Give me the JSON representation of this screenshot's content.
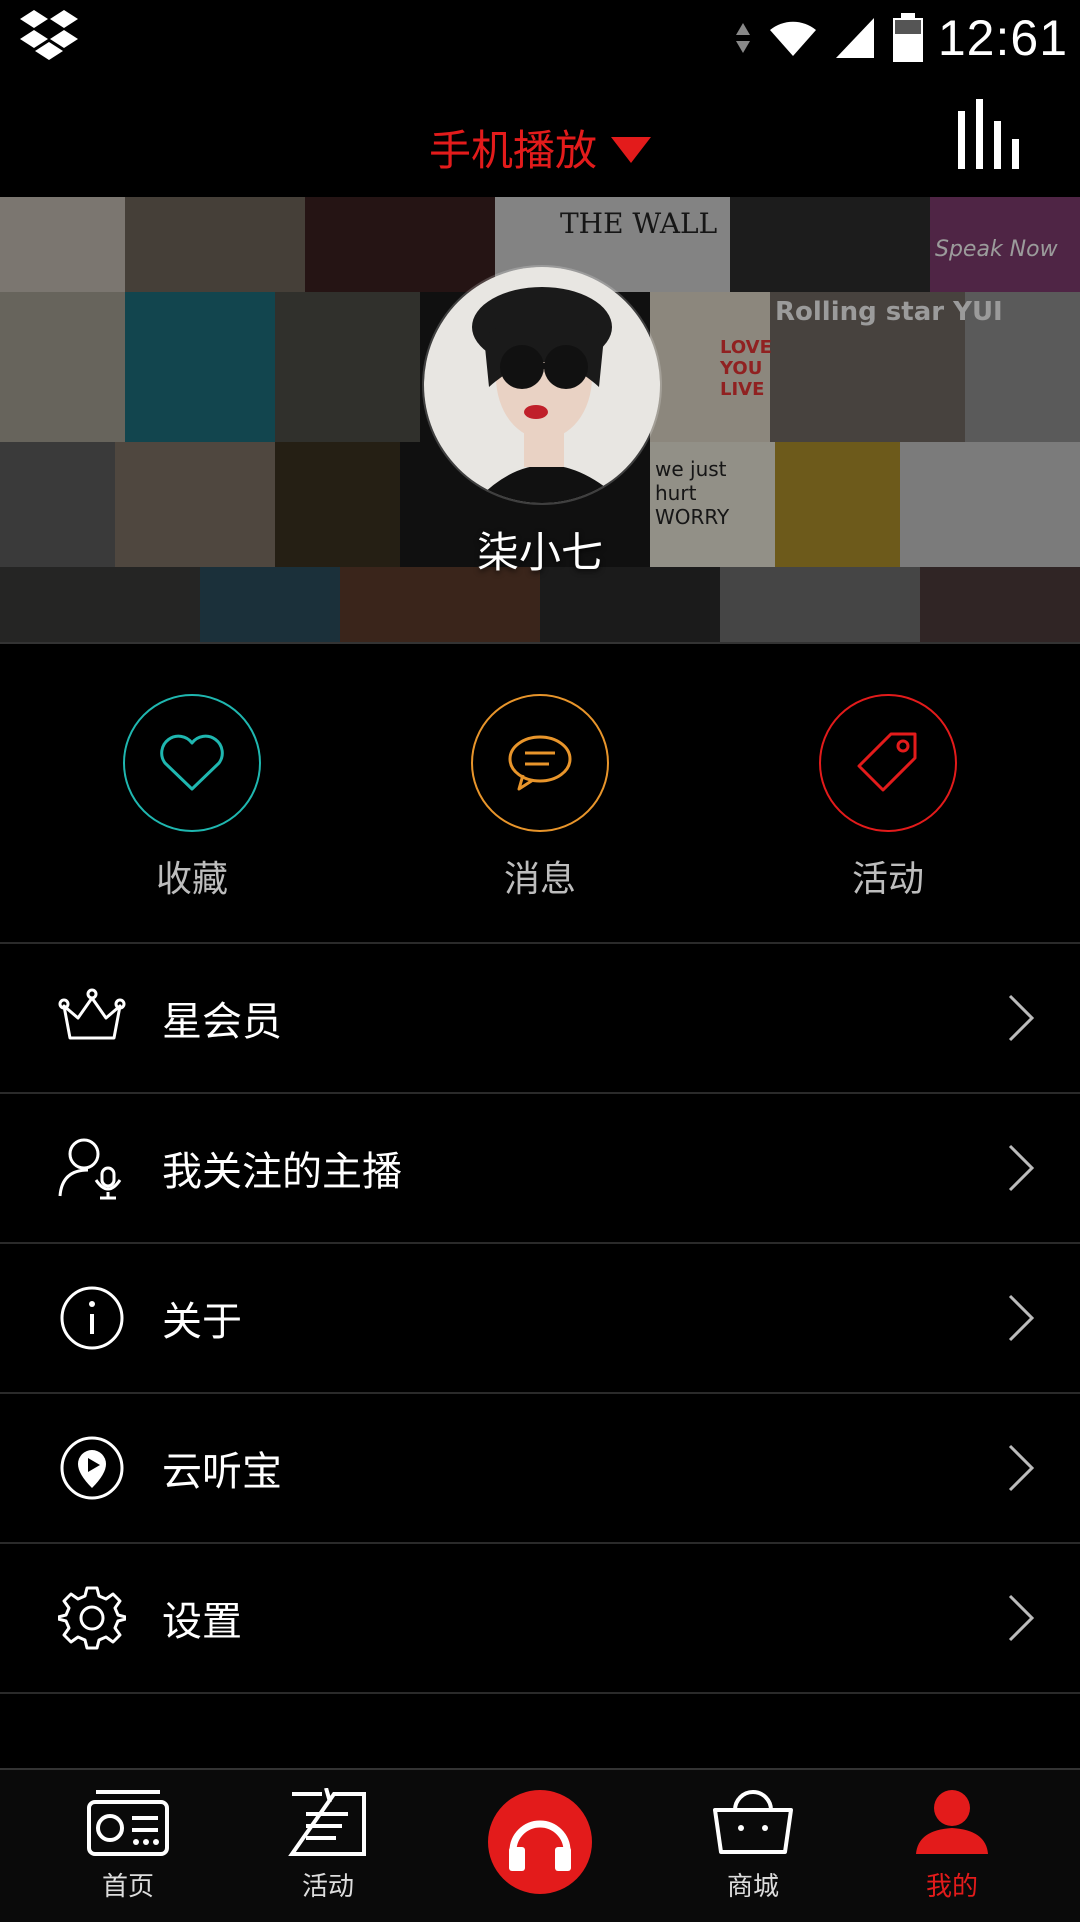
{
  "status_bar": {
    "time": "12:61"
  },
  "header": {
    "title": "手机播放"
  },
  "profile": {
    "username": "柒小七"
  },
  "quick_actions": [
    {
      "label": "收藏",
      "icon": "heart-icon",
      "color": "#1fb7b0"
    },
    {
      "label": "消息",
      "icon": "message-icon",
      "color": "#e8952b"
    },
    {
      "label": "活动",
      "icon": "tag-icon",
      "color": "#e31b1b"
    }
  ],
  "menu": [
    {
      "label": "星会员",
      "icon": "crown-icon"
    },
    {
      "label": "我关注的主播",
      "icon": "user-mic-icon"
    },
    {
      "label": "关于",
      "icon": "info-icon"
    },
    {
      "label": "云听宝",
      "icon": "play-pin-icon"
    },
    {
      "label": "设置",
      "icon": "gear-icon"
    }
  ],
  "tabbar": [
    {
      "label": "首页",
      "icon": "radio-icon"
    },
    {
      "label": "活动",
      "icon": "list-board-icon"
    },
    {
      "label": "",
      "icon": "headphones-icon"
    },
    {
      "label": "商城",
      "icon": "basket-icon"
    },
    {
      "label": "我的",
      "icon": "user-icon",
      "active": true
    }
  ],
  "colors": {
    "accent": "#e31b1b",
    "teal": "#1fb7b0",
    "orange": "#e8952b"
  },
  "banner_texts": {
    "album1": "THE WALL",
    "album2": "Rolling star YUI",
    "album3": "we just hurt WORRY",
    "album4": "Speak Now",
    "album5": "LOVE YOU LIVE"
  }
}
